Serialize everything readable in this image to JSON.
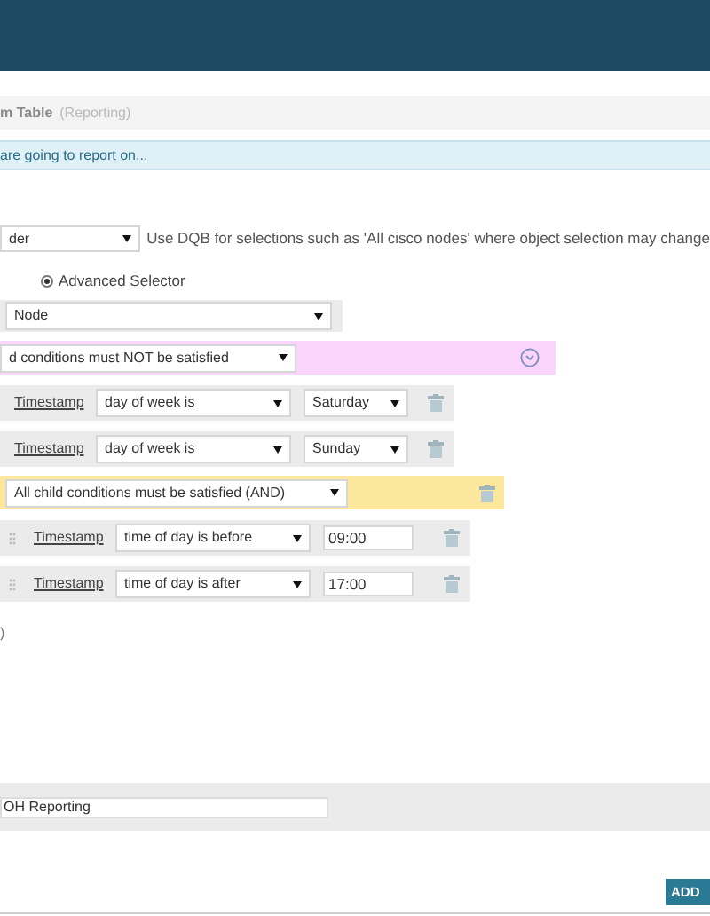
{
  "page_title": {
    "name": "m Table",
    "suffix": "(Reporting)"
  },
  "info_bar": "are going to report on...",
  "selection_method": {
    "value": "der",
    "hint": "Use DQB for selections such as 'All cisco nodes' where object selection may change"
  },
  "selector_option": {
    "label": "Advanced Selector",
    "selected": true
  },
  "object_type": "Node",
  "groups": [
    {
      "kind": "collapsible",
      "condition": "d conditions must NOT be satisfied",
      "color": "#fad4fa",
      "rules": [
        {
          "field": "Timestamp",
          "operator": "day of week is",
          "kind": "select",
          "value": "Saturday"
        },
        {
          "field": "Timestamp",
          "operator": "day of week is",
          "kind": "select",
          "value": "Sunday"
        }
      ]
    },
    {
      "kind": "nested",
      "condition": "All child conditions must be satisfied (AND)",
      "color": "#fde79d",
      "rules": [
        {
          "field": "Timestamp",
          "operator": "time of day is before",
          "kind": "input",
          "value": "09:00"
        },
        {
          "field": "Timestamp",
          "operator": "time of day is after",
          "kind": "input",
          "value": "17:00"
        }
      ]
    }
  ],
  "closing_mark": ")",
  "name_field": "OH Reporting",
  "add_button": "ADD"
}
